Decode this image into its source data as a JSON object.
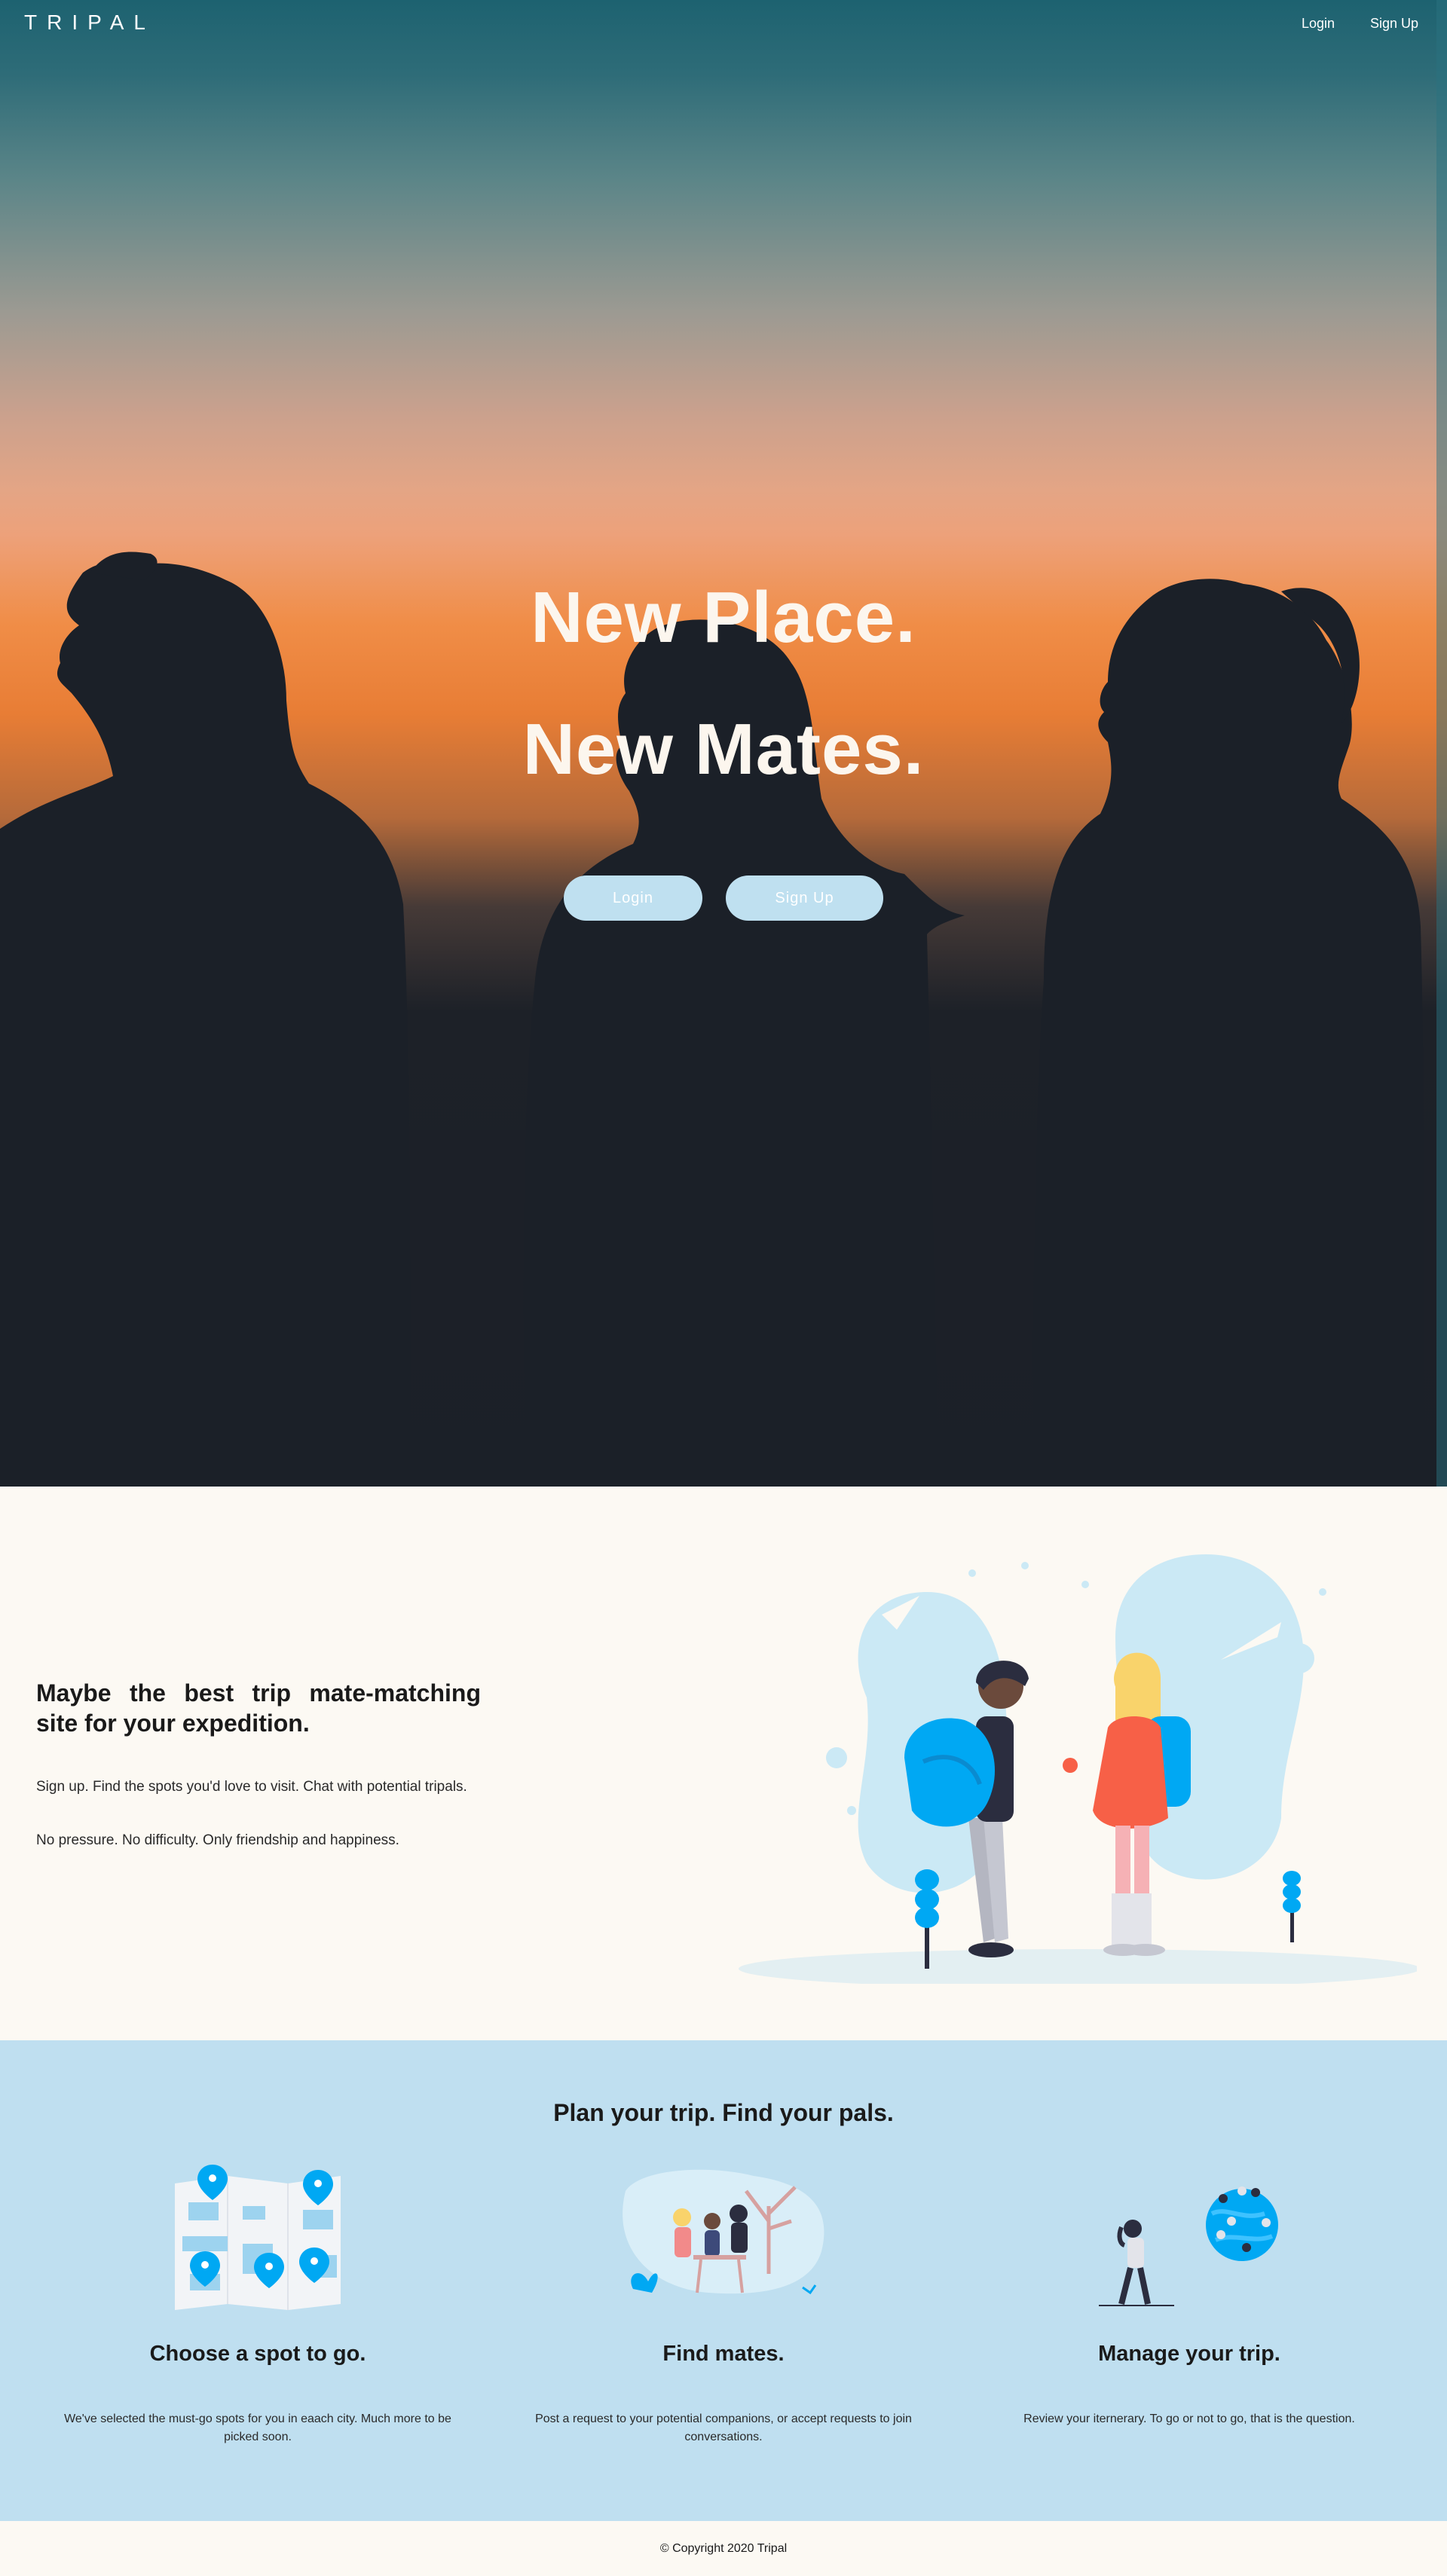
{
  "nav": {
    "logo": "TRIPAL",
    "login_label": "Login",
    "signup_label": "Sign Up"
  },
  "hero": {
    "line1": "New Place.",
    "line2": "New Mates.",
    "login_label": "Login",
    "signup_label": "Sign Up"
  },
  "about": {
    "headline": "Maybe the best trip mate-matching site for your expedition.",
    "paragraph1": "Sign up. Find the spots you'd love to visit. Chat with potential tripals.",
    "paragraph2": "No pressure. No difficulty. Only friendship and happiness."
  },
  "features": {
    "title": "Plan your trip. Find your pals.",
    "items": [
      {
        "icon": "map-icon",
        "name": "Choose a spot to go.",
        "description": "We've selected the must-go spots for you in eaach city. Much more to be picked soon."
      },
      {
        "icon": "friends-meeting-icon",
        "name": "Find mates.",
        "description": "Post a request to your potential companions, or accept requests to join conversations."
      },
      {
        "icon": "globe-itinerary-icon",
        "name": "Manage your trip.",
        "description": "Review your iternerary. To go or not to go, that is the question."
      }
    ]
  },
  "footer": {
    "copyright": "© Copyright 2020 Tripal"
  },
  "colors": {
    "button_bg": "#bfe0f0",
    "features_bg": "#bfdff0",
    "cream_bg": "#fcf9f3",
    "accent_blue": "#00a8f3",
    "silhouette": "#1b2028"
  }
}
